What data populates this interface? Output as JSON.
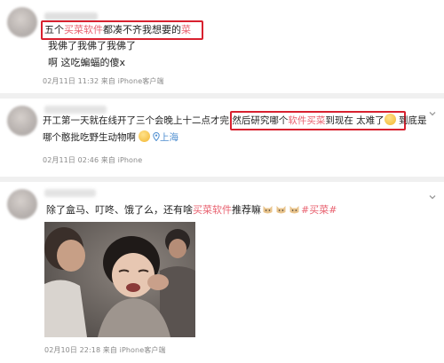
{
  "posts": [
    {
      "line1_pre": "五个",
      "line1_hl": "买菜软件",
      "line1_mid": "都凑不齐我想要的",
      "line1_end": "菜",
      "line2": "我佛了我佛了我佛了",
      "line3": "啊 这吃蝙蝠的傻x",
      "meta": "02月11日 11:32  来自 iPhone客户端"
    },
    {
      "line1_pre": "开工第一天就在线开了三个会晚上十二点才完",
      "line1_mid": " 然后研究哪个",
      "line1_hl": "软件买菜",
      "line1_post": "到现在 太难了",
      "line1_end": " 到底是",
      "line2": "哪个憨批吃野生动物啊",
      "location": "上海",
      "meta": "02月11日 02:46  来自 iPhone"
    },
    {
      "line1_pre": "除了盒马、叮咚、饿了么，还有啥",
      "line1_hl": "买菜软件",
      "line1_mid": "推荐嘛",
      "hashtag": "#买菜#",
      "meta": "02月10日 22:18  来自 iPhone客户端"
    }
  ],
  "colors": {
    "highlight": "#e8616f",
    "box": "#d8212f",
    "location": "#4b8ccf"
  },
  "icons": [
    "chevron-down-icon",
    "location-pin-icon",
    "sad-face-emoji",
    "crying-emoji",
    "cat-emoji"
  ]
}
